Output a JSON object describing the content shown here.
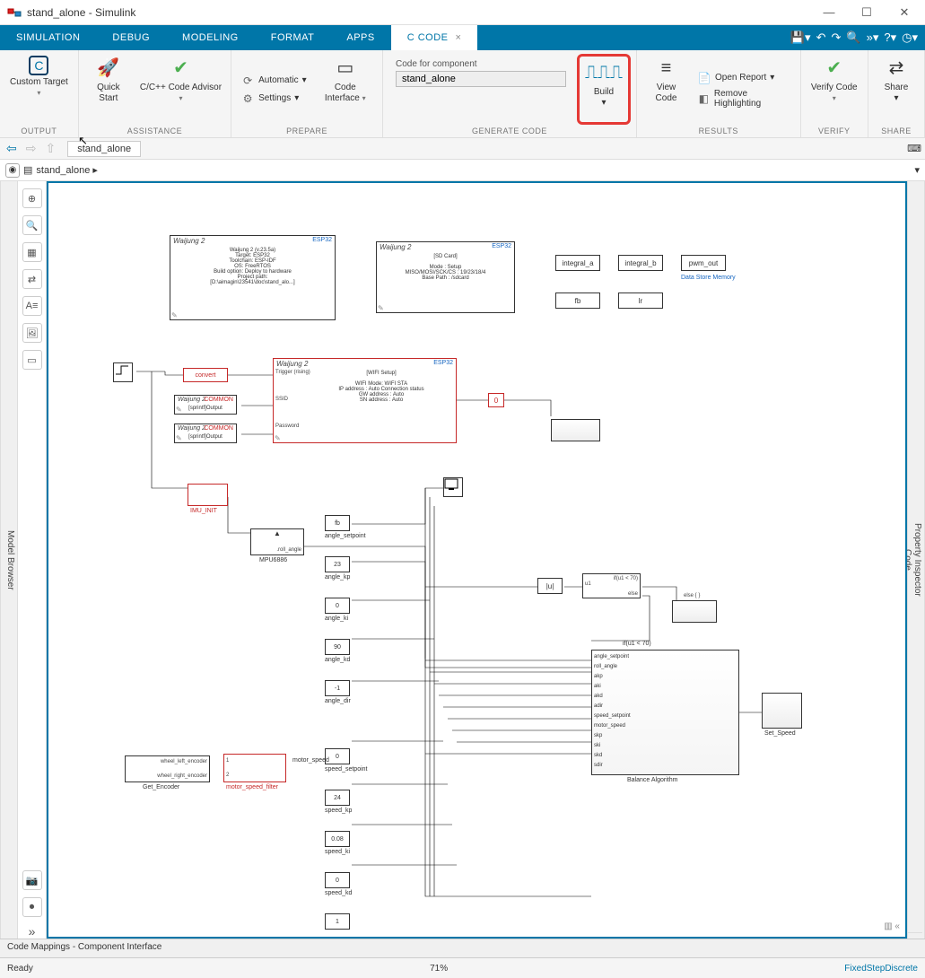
{
  "title": "stand_alone - Simulink",
  "tabs": [
    "SIMULATION",
    "DEBUG",
    "MODELING",
    "FORMAT",
    "APPS",
    "C CODE"
  ],
  "active_tab": 5,
  "toolstrip": {
    "output": {
      "custom_target": "Custom Target",
      "group": "OUTPUT"
    },
    "assistance": {
      "quick_start": "Quick Start",
      "advisor": "C/C++ Code Advisor",
      "group": "ASSISTANCE"
    },
    "prepare": {
      "automatic": "Automatic",
      "settings": "Settings",
      "code_interface": "Code Interface",
      "group": "PREPARE"
    },
    "generate": {
      "code_for_label": "Code for component",
      "code_for_value": "stand_alone",
      "build": "Build",
      "group": "GENERATE CODE"
    },
    "results": {
      "view_code": "View Code",
      "open_report": "Open Report",
      "remove_hl": "Remove Highlighting",
      "group": "RESULTS"
    },
    "verify": {
      "verify_code": "Verify Code",
      "group": "VERIFY"
    },
    "share": {
      "share": "Share",
      "group": "SHARE"
    }
  },
  "nav": {
    "tab": "stand_alone",
    "breadcrumb": "stand_alone"
  },
  "side": {
    "left": "Model Browser",
    "right_top": "Property Inspector",
    "right_bottom": "Code"
  },
  "bottom": {
    "codemap": "Code Mappings - Component Interface",
    "ready": "Ready",
    "zoom": "71%",
    "solver": "FixedStepDiscrete"
  },
  "canvas": {
    "waijung_main": {
      "title": "Waijung 2",
      "tag": "ESP32",
      "lines": [
        "Waijung 2 (v.23.5a)",
        "Target: ESP32",
        "Toolchain: ESP-IDF",
        "OS: FreeRTOS",
        "Build option: Deploy to hardware",
        "Project path:",
        "[D:\\aimagin\\23541\\doc\\stand_alo...]"
      ]
    },
    "sdcard": {
      "title": "Waijung 2",
      "tag": "ESP32",
      "lines": [
        "[SD Card]",
        "",
        "Mode : Setup",
        "MISO/MOSI/SCK/CS : 19/23/18/4",
        "Base Path : /sdcard"
      ]
    },
    "ds_blocks": [
      "integral_a",
      "integral_b",
      "pwm_out",
      "fb",
      "lr"
    ],
    "ds_mem": "Data Store Memory",
    "convert": "convert",
    "common": "COMMON",
    "sprintf": "[sprintf]Output",
    "wifi": {
      "title": "Waijung 2",
      "tag": "ESP32",
      "trig": "Trigger (rising)",
      "lines": [
        "[WIFI Setup]",
        "",
        "WIFI Mode: WIFI STA",
        "IP address    : Auto    Connection status",
        "GW address  : Auto",
        "SN address  : Auto"
      ],
      "ssid": "SSID",
      "pwd": "Password"
    },
    "imu_init": "IMU_INIT",
    "mpu": {
      "roll": ".roll_angle",
      "label": "MPU6886"
    },
    "consts": [
      {
        "v": "fb",
        "l": "angle_setpoint"
      },
      {
        "v": "23",
        "l": "angle_kp"
      },
      {
        "v": "0",
        "l": "angle_ki"
      },
      {
        "v": "90",
        "l": "angle_kd"
      },
      {
        "v": "-1",
        "l": "angle_dir"
      },
      {
        "v": "0",
        "l": "speed_setpoint"
      },
      {
        "v": "24",
        "l": "speed_kp"
      },
      {
        "v": "0.08",
        "l": "speed_ki"
      },
      {
        "v": "0",
        "l": "speed_kd"
      },
      {
        "v": "1",
        "l": ""
      }
    ],
    "get_enc": {
      "in1": "wheel_left_encoder",
      "in2": "wheel_right_encoder",
      "label": "Get_Encoder"
    },
    "msf": "motor_speed_filter",
    "msf_out": "motor_speed",
    "abs": "|u|",
    "ifblk": {
      "c1": "if(u1 < 70)",
      "c2": "else",
      "in": "u1"
    },
    "else_sub": "else { }",
    "ifu1": "if(u1 < 70)",
    "balance": {
      "label": "Balance Algorithm",
      "ports": [
        "angle_setpoint",
        "roll_angle",
        "akp",
        "aki",
        "akd",
        "adir",
        "speed_setpoint",
        "motor_speed",
        "skp",
        "ski",
        "skd",
        "sdir"
      ]
    },
    "set_speed": "Set_Speed"
  }
}
